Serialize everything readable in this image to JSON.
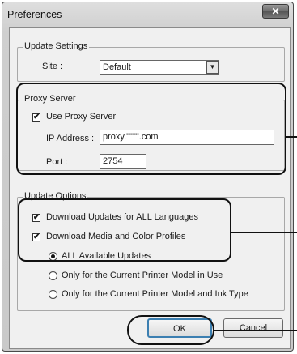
{
  "window": {
    "title": "Preferences",
    "close_glyph": "✕"
  },
  "update_settings": {
    "legend": "Update Settings",
    "site_label": "Site :",
    "site_value": "Default",
    "dropdown_icon": "chevron-down-icon"
  },
  "proxy_server": {
    "legend": "Proxy Server",
    "use_proxy_label": "Use Proxy Server",
    "use_proxy_checked": true,
    "ip_label": "IP Address :",
    "ip_value": "proxy.\"\"\"\".com",
    "port_label": "Port :",
    "port_value": "2754"
  },
  "update_options": {
    "legend": "Update Options",
    "download_all_languages": {
      "label": "Download Updates for ALL Languages",
      "checked": true
    },
    "download_media": {
      "label": "Download Media and Color Profiles",
      "checked": true
    },
    "radios": [
      {
        "label": "ALL Available Updates",
        "selected": true
      },
      {
        "label": "Only for the Current Printer Model in Use",
        "selected": false
      },
      {
        "label": "Only for the Current Printer Model and Ink Type",
        "selected": false
      }
    ]
  },
  "buttons": {
    "ok": "OK",
    "cancel": "Cancel"
  },
  "check_glyph": "✔"
}
